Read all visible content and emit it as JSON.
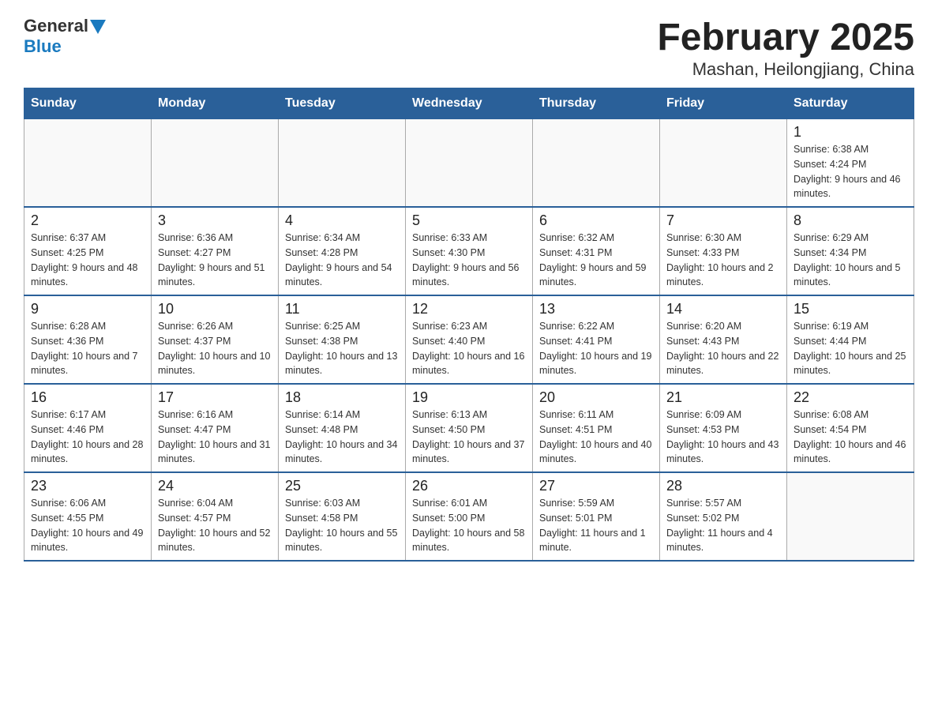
{
  "logo": {
    "general": "General",
    "blue": "Blue"
  },
  "title": {
    "month": "February 2025",
    "location": "Mashan, Heilongjiang, China"
  },
  "weekdays": [
    "Sunday",
    "Monday",
    "Tuesday",
    "Wednesday",
    "Thursday",
    "Friday",
    "Saturday"
  ],
  "weeks": [
    [
      {
        "day": "",
        "info": ""
      },
      {
        "day": "",
        "info": ""
      },
      {
        "day": "",
        "info": ""
      },
      {
        "day": "",
        "info": ""
      },
      {
        "day": "",
        "info": ""
      },
      {
        "day": "",
        "info": ""
      },
      {
        "day": "1",
        "info": "Sunrise: 6:38 AM\nSunset: 4:24 PM\nDaylight: 9 hours and 46 minutes."
      }
    ],
    [
      {
        "day": "2",
        "info": "Sunrise: 6:37 AM\nSunset: 4:25 PM\nDaylight: 9 hours and 48 minutes."
      },
      {
        "day": "3",
        "info": "Sunrise: 6:36 AM\nSunset: 4:27 PM\nDaylight: 9 hours and 51 minutes."
      },
      {
        "day": "4",
        "info": "Sunrise: 6:34 AM\nSunset: 4:28 PM\nDaylight: 9 hours and 54 minutes."
      },
      {
        "day": "5",
        "info": "Sunrise: 6:33 AM\nSunset: 4:30 PM\nDaylight: 9 hours and 56 minutes."
      },
      {
        "day": "6",
        "info": "Sunrise: 6:32 AM\nSunset: 4:31 PM\nDaylight: 9 hours and 59 minutes."
      },
      {
        "day": "7",
        "info": "Sunrise: 6:30 AM\nSunset: 4:33 PM\nDaylight: 10 hours and 2 minutes."
      },
      {
        "day": "8",
        "info": "Sunrise: 6:29 AM\nSunset: 4:34 PM\nDaylight: 10 hours and 5 minutes."
      }
    ],
    [
      {
        "day": "9",
        "info": "Sunrise: 6:28 AM\nSunset: 4:36 PM\nDaylight: 10 hours and 7 minutes."
      },
      {
        "day": "10",
        "info": "Sunrise: 6:26 AM\nSunset: 4:37 PM\nDaylight: 10 hours and 10 minutes."
      },
      {
        "day": "11",
        "info": "Sunrise: 6:25 AM\nSunset: 4:38 PM\nDaylight: 10 hours and 13 minutes."
      },
      {
        "day": "12",
        "info": "Sunrise: 6:23 AM\nSunset: 4:40 PM\nDaylight: 10 hours and 16 minutes."
      },
      {
        "day": "13",
        "info": "Sunrise: 6:22 AM\nSunset: 4:41 PM\nDaylight: 10 hours and 19 minutes."
      },
      {
        "day": "14",
        "info": "Sunrise: 6:20 AM\nSunset: 4:43 PM\nDaylight: 10 hours and 22 minutes."
      },
      {
        "day": "15",
        "info": "Sunrise: 6:19 AM\nSunset: 4:44 PM\nDaylight: 10 hours and 25 minutes."
      }
    ],
    [
      {
        "day": "16",
        "info": "Sunrise: 6:17 AM\nSunset: 4:46 PM\nDaylight: 10 hours and 28 minutes."
      },
      {
        "day": "17",
        "info": "Sunrise: 6:16 AM\nSunset: 4:47 PM\nDaylight: 10 hours and 31 minutes."
      },
      {
        "day": "18",
        "info": "Sunrise: 6:14 AM\nSunset: 4:48 PM\nDaylight: 10 hours and 34 minutes."
      },
      {
        "day": "19",
        "info": "Sunrise: 6:13 AM\nSunset: 4:50 PM\nDaylight: 10 hours and 37 minutes."
      },
      {
        "day": "20",
        "info": "Sunrise: 6:11 AM\nSunset: 4:51 PM\nDaylight: 10 hours and 40 minutes."
      },
      {
        "day": "21",
        "info": "Sunrise: 6:09 AM\nSunset: 4:53 PM\nDaylight: 10 hours and 43 minutes."
      },
      {
        "day": "22",
        "info": "Sunrise: 6:08 AM\nSunset: 4:54 PM\nDaylight: 10 hours and 46 minutes."
      }
    ],
    [
      {
        "day": "23",
        "info": "Sunrise: 6:06 AM\nSunset: 4:55 PM\nDaylight: 10 hours and 49 minutes."
      },
      {
        "day": "24",
        "info": "Sunrise: 6:04 AM\nSunset: 4:57 PM\nDaylight: 10 hours and 52 minutes."
      },
      {
        "day": "25",
        "info": "Sunrise: 6:03 AM\nSunset: 4:58 PM\nDaylight: 10 hours and 55 minutes."
      },
      {
        "day": "26",
        "info": "Sunrise: 6:01 AM\nSunset: 5:00 PM\nDaylight: 10 hours and 58 minutes."
      },
      {
        "day": "27",
        "info": "Sunrise: 5:59 AM\nSunset: 5:01 PM\nDaylight: 11 hours and 1 minute."
      },
      {
        "day": "28",
        "info": "Sunrise: 5:57 AM\nSunset: 5:02 PM\nDaylight: 11 hours and 4 minutes."
      },
      {
        "day": "",
        "info": ""
      }
    ]
  ]
}
